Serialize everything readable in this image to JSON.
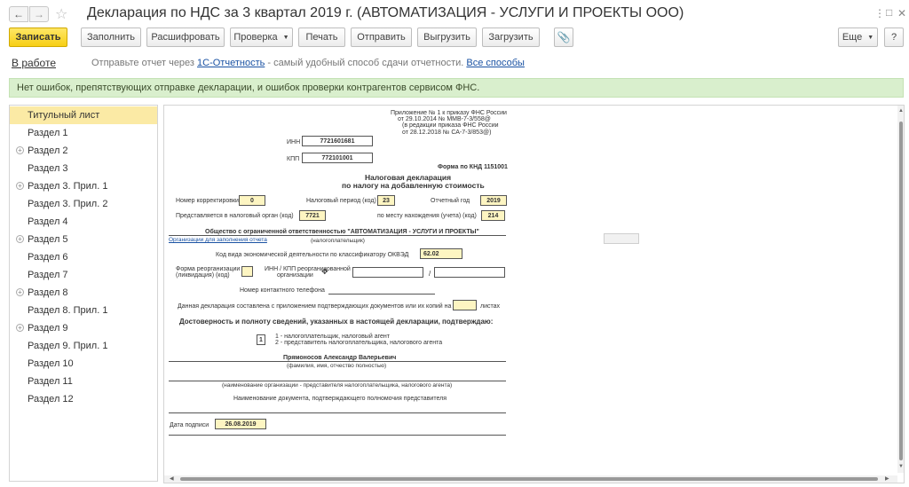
{
  "window": {
    "title": "Декларация по НДС за 3 квартал 2019 г. (АВТОМАТИЗАЦИЯ - УСЛУГИ И ПРОЕКТЫ ООО)",
    "back_icon": "arrow-left",
    "forward_icon": "arrow-right",
    "favorite_icon": "star",
    "more_icon": "vertical-dots",
    "maximize_icon": "square",
    "close_icon": "x"
  },
  "toolbar": {
    "save": "Записать",
    "fill": "Заполнить",
    "decode": "Расшифровать",
    "check": "Проверка",
    "print": "Печать",
    "send": "Отправить",
    "export": "Выгрузить",
    "import": "Загрузить",
    "attach_icon": "paperclip",
    "more": "Еще",
    "help": "?"
  },
  "status": {
    "state": "В работе",
    "hint_prefix": "Отправьте отчет через",
    "hint_link": "1С-Отчетность",
    "hint_suffix": "- самый удобный способ сдачи отчетности.",
    "all_ways": "Все способы"
  },
  "banner": {
    "text": "Нет ошибок, препятствующих отправке декларации, и ошибок проверки контрагентов сервисом ФНС."
  },
  "sidebar": {
    "items": [
      {
        "label": "Титульный лист",
        "active": true,
        "expandable": false
      },
      {
        "label": "Раздел 1",
        "active": false,
        "expandable": false
      },
      {
        "label": "Раздел 2",
        "active": false,
        "expandable": true
      },
      {
        "label": "Раздел 3",
        "active": false,
        "expandable": false
      },
      {
        "label": "Раздел 3. Прил. 1",
        "active": false,
        "expandable": true
      },
      {
        "label": "Раздел 3. Прил. 2",
        "active": false,
        "expandable": false
      },
      {
        "label": "Раздел 4",
        "active": false,
        "expandable": false
      },
      {
        "label": "Раздел 5",
        "active": false,
        "expandable": true
      },
      {
        "label": "Раздел 6",
        "active": false,
        "expandable": false
      },
      {
        "label": "Раздел 7",
        "active": false,
        "expandable": false
      },
      {
        "label": "Раздел 8",
        "active": false,
        "expandable": true
      },
      {
        "label": "Раздел 8. Прил. 1",
        "active": false,
        "expandable": false
      },
      {
        "label": "Раздел 9",
        "active": false,
        "expandable": true
      },
      {
        "label": "Раздел 9. Прил. 1",
        "active": false,
        "expandable": false
      },
      {
        "label": "Раздел 10",
        "active": false,
        "expandable": false
      },
      {
        "label": "Раздел 11",
        "active": false,
        "expandable": false
      },
      {
        "label": "Раздел 12",
        "active": false,
        "expandable": false
      }
    ]
  },
  "form": {
    "appendix_1": "Приложение № 1 к приказу ФНС России",
    "appendix_2": "от 29.10.2014 № ММВ-7-3/558@",
    "appendix_3": "(в редакции приказа ФНС России",
    "appendix_4": "от 28.12.2018 № СА-7-3/853@)",
    "inn_label": "ИНН",
    "inn": "7721601681",
    "kpp_label": "КПП",
    "kpp": "772101001",
    "knd": "Форма по КНД 1151001",
    "title_1": "Налоговая декларация",
    "title_2": "по налогу на добавленную стоимость",
    "correction_label": "Номер корректировки",
    "correction": "0",
    "period_label": "Налоговый период (код)",
    "period": "23",
    "year_label": "Отчетный год",
    "year": "2019",
    "authority_label": "Представляется в налоговый орган (код)",
    "authority": "7721",
    "location_label": "по месту нахождения (учета) (код)",
    "location": "214",
    "org_name": "Общество с ограниченной ответственностью \"АВТОМАТИЗАЦИЯ - УСЛУГИ И ПРОЕКТЫ\"",
    "org_link": "Организации для заполнения отчета",
    "taxpayer_caption": "(налогоплательщик)",
    "okved_label": "Код вида экономической деятельности по классификатору ОКВЭД",
    "okved": "62.02",
    "reorg_label_1": "Форма реорганизации",
    "reorg_label_2": "(ликвидация) (код)",
    "reorg_inn_label_1": "ИНН / КПП реорганизованной",
    "reorg_inn_label_2": "организации",
    "slash": "/",
    "phone_label": "Номер контактного телефона",
    "attached_label": "Данная декларация составлена с приложением подтверждающих документов или их копий на",
    "sheets": "листах",
    "confirm_title": "Достоверность и полноту сведений, указанных в настоящей декларации, подтверждаю:",
    "signer_code": "1",
    "signer_opt_1": "1 - налогоплательщик, налоговый агент",
    "signer_opt_2": "2 - представитель налогоплательщика, налогового агента",
    "signer_name": "Прямоносов Александр Валерьевич",
    "signer_caption": "(фамилия, имя, отчество полностью)",
    "rep_org_caption": "(наименование организации - представителя налогоплательщика, налогового агента)",
    "doc_caption": "Наименование документа, подтверждающего полномочия представителя",
    "sign_date_label": "Дата подписи",
    "sign_date": "26.08.2019"
  },
  "colors": {
    "accent_yellow": "#f7cf15",
    "banner_green": "#d9efcd",
    "field_yellow": "#fdf5c2",
    "link_blue": "#1a52a3",
    "sidebar_active": "#fbeaa5"
  }
}
